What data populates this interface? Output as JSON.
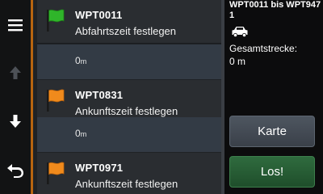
{
  "nav": {
    "menu_icon": "hamburger-menu-icon",
    "up_icon": "arrow-up-icon",
    "down_icon": "arrow-down-icon",
    "back_icon": "back-arrow-icon"
  },
  "waypoints": [
    {
      "name": "WPT0011",
      "action": "Abfahrtszeit festlegen",
      "flag_color": "#2fb52a",
      "flag_icon": "green-flag-icon"
    },
    {
      "name": "WPT0831",
      "action": "Ankunftszeit festlegen",
      "flag_color": "#f08a1c",
      "flag_icon": "orange-flag-icon"
    },
    {
      "name": "WPT0971",
      "action": "Ankunftszeit festlegen",
      "flag_color": "#f08a1c",
      "flag_icon": "orange-flag-icon"
    }
  ],
  "legs": [
    {
      "value": "0",
      "unit": "m"
    },
    {
      "value": "0",
      "unit": "m"
    }
  ],
  "side": {
    "route_title": "WPT0011 bis WPT947 1",
    "vehicle_icon": "car-icon",
    "total_label": "Gesamtstrecke:",
    "total_value": "0 m",
    "map_button": "Karte",
    "go_button": "Los!"
  },
  "colors": {
    "accent_divider": "#b8650f",
    "go_button": "#2a5e37",
    "map_button": "#454c55"
  }
}
